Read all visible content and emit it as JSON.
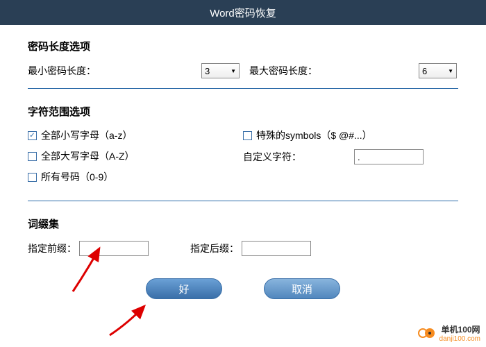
{
  "header": {
    "title": "Word密码恢复"
  },
  "length": {
    "section_title": "密码长度选项",
    "min_label": "最小密码长度：",
    "min_value": "3",
    "max_label": "最大密码长度：",
    "max_value": "6"
  },
  "chars": {
    "section_title": "字符范围选项",
    "lowercase_label": "全部小写字母（a-z）",
    "uppercase_label": "全部大写字母（A-Z）",
    "digits_label": "所有号码（0-9）",
    "symbols_label": "特殊的symbols（$ @#...）",
    "custom_label": "自定义字符：",
    "custom_value": "."
  },
  "affix": {
    "section_title": "词缀集",
    "prefix_label": "指定前缀：",
    "prefix_value": "",
    "suffix_label": "指定后缀：",
    "suffix_value": ""
  },
  "buttons": {
    "ok": "好",
    "cancel": "取消"
  },
  "watermark": {
    "line1": "单机100网",
    "line2": "danji100.com"
  }
}
